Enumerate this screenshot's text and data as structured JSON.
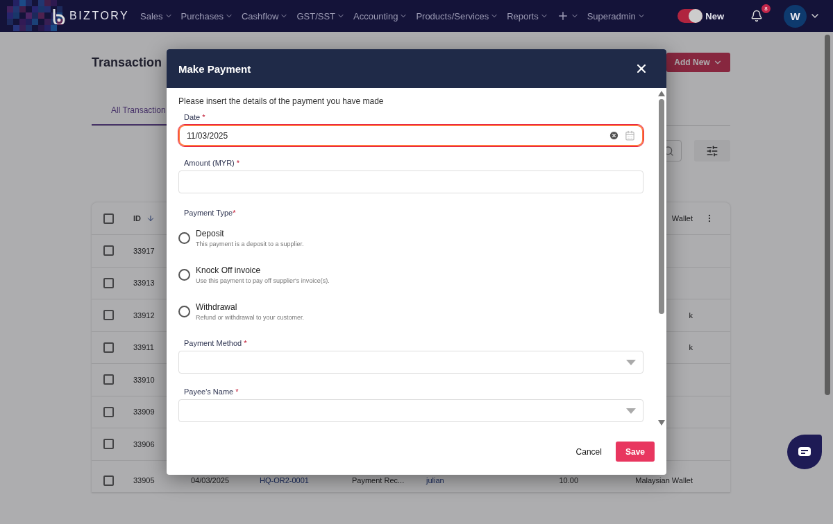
{
  "navbar": {
    "brand": "BIZTORY",
    "menu": [
      {
        "kind": "text",
        "label": "Sales"
      },
      {
        "kind": "text",
        "label": "Purchases"
      },
      {
        "kind": "text",
        "label": "Cashflow"
      },
      {
        "kind": "text",
        "label": "GST/SST"
      },
      {
        "kind": "text",
        "label": "Accounting"
      },
      {
        "kind": "text",
        "label": "Products/Services"
      },
      {
        "kind": "text",
        "label": "Reports"
      },
      {
        "kind": "add"
      },
      {
        "kind": "text",
        "label": "Superadmin"
      }
    ],
    "toggle": {
      "on": true,
      "label": "New"
    },
    "notifications": {
      "count": "8"
    },
    "avatar": {
      "initial": "W"
    }
  },
  "page": {
    "title": "Transaction",
    "add_button": "Add New",
    "tabs": [
      {
        "label": "All Transaction",
        "selected": true
      }
    ],
    "table": {
      "header_checked": false,
      "columns": [
        {
          "label": "ID",
          "sorted": true
        },
        {
          "label": "Wallet"
        }
      ],
      "rows": [
        {
          "id": "33917",
          "checked": false
        },
        {
          "id": "33913",
          "checked": false
        },
        {
          "id": "33912",
          "checked": false,
          "wallet": "k"
        },
        {
          "id": "33911",
          "checked": false,
          "wallet": "k"
        },
        {
          "id": "33910",
          "checked": false
        },
        {
          "id": "33909",
          "checked": false
        },
        {
          "id": "33906",
          "checked": false
        },
        {
          "id": "33905",
          "checked": false,
          "date": "04/03/2025",
          "reference": "HQ-OR2-0001",
          "type": "Payment Rec...",
          "name": "julian",
          "amount": "10.00",
          "wallet": "Malaysian Wallet"
        }
      ]
    }
  },
  "dialog": {
    "title": "Make Payment",
    "intro": "Please insert the details of the payment you have made",
    "fields": [
      {
        "kind": "date",
        "label": "Date",
        "required": true,
        "required_mark": "*",
        "value": "11/03/2025",
        "focused": true
      },
      {
        "kind": "text",
        "label": "Amount (MYR)",
        "required": true,
        "required_mark": "*",
        "focused": false
      },
      {
        "kind": "radio",
        "label": "Payment Type",
        "required": true,
        "required_mark": "*",
        "options": [
          {
            "label": "Deposit",
            "description": "This payment is a deposit to a supplier.",
            "selected": false
          },
          {
            "label": "Knock Off invoice",
            "description": "Use this payment to pay off supplier's invoice(s).",
            "selected": false
          },
          {
            "label": "Withdrawal",
            "description": "Refund or withdrawal to your customer.",
            "selected": false
          }
        ]
      },
      {
        "kind": "select",
        "label": "Payment Method",
        "required": true,
        "required_mark": "*",
        "focused": false
      },
      {
        "kind": "select",
        "label": "Payee's Name",
        "required": true,
        "required_mark": "*",
        "focused": false
      }
    ],
    "buttons": [
      {
        "kind": "cancel",
        "label": "Cancel"
      },
      {
        "kind": "save",
        "label": "Save"
      }
    ]
  }
}
